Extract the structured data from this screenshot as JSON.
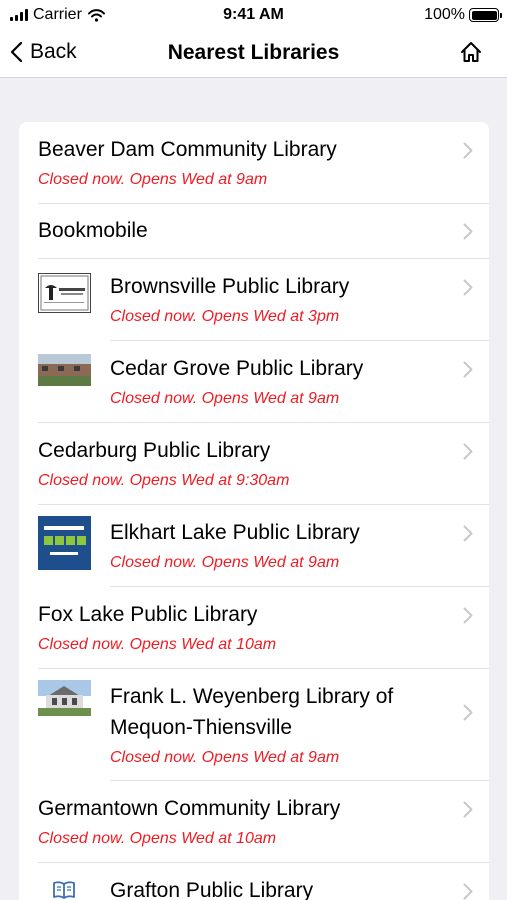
{
  "status_bar": {
    "carrier": "Carrier",
    "time": "9:41 AM",
    "battery": "100%"
  },
  "nav": {
    "back_label": "Back",
    "title": "Nearest Libraries"
  },
  "libraries": [
    {
      "name": "Beaver Dam Community Library",
      "status": "Closed now. Opens Wed at 9am"
    },
    {
      "name": "Bookmobile"
    },
    {
      "name": "Brownsville Public Library",
      "status": "Closed now. Opens Wed at 3pm",
      "thumb_logo_text": "BROWNSVILLE PUBLIC LIBRARY"
    },
    {
      "name": "Cedar Grove Public Library",
      "status": "Closed now. Opens Wed at 9am"
    },
    {
      "name": "Cedarburg Public Library",
      "status": "Closed now. Opens Wed at 9:30am"
    },
    {
      "name": "Elkhart Lake Public Library",
      "status": "Closed now. Opens Wed at 9am",
      "thumb_logo_text": "Elkhart Lake Public Library"
    },
    {
      "name": "Fox Lake Public Library",
      "status": "Closed now. Opens Wed at 10am"
    },
    {
      "name_line1": "Frank L. Weyenberg Library of",
      "name_line2": "Mequon-Thiensville",
      "status": "Closed now. Opens Wed at 9am"
    },
    {
      "name": "Germantown Community Library",
      "status": "Closed now. Opens Wed at 10am"
    },
    {
      "name": "Grafton Public Library"
    }
  ],
  "colors": {
    "status_red": "#ee1c24",
    "chevron": "#c7c7cc",
    "background": "#efeff4",
    "book_icon_blue": "#3a6fb0"
  },
  "icons": {
    "back": "chevron-left-icon",
    "home": "home-icon",
    "row": "chevron-right-icon",
    "grafton": "book-icon"
  }
}
